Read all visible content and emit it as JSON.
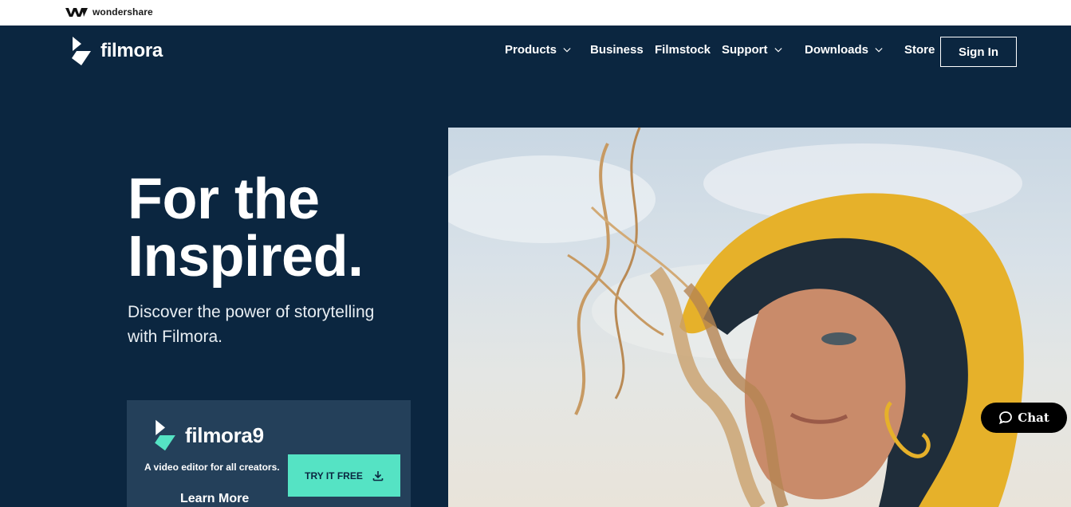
{
  "topbar": {
    "brand": "wondershare"
  },
  "nav": {
    "brand": "filmora",
    "items": [
      {
        "label": "Products",
        "dropdown": true
      },
      {
        "label": "Business",
        "dropdown": false
      },
      {
        "label": "Filmstock",
        "dropdown": false
      },
      {
        "label": "Support",
        "dropdown": true
      },
      {
        "label": "Downloads",
        "dropdown": true
      },
      {
        "label": "Store",
        "dropdown": false
      }
    ],
    "sign_in": "Sign In"
  },
  "hero": {
    "title_line1": "For the",
    "title_line2": "Inspired.",
    "subtitle_line1": "Discover the power of storytelling",
    "subtitle_line2": "with Filmora."
  },
  "product_card": {
    "brand": "filmora",
    "version": "9",
    "tagline": "A video editor for all creators.",
    "try_button": "TRY IT FREE",
    "learn_more": "Learn More"
  },
  "chat": {
    "label": "Chat"
  },
  "colors": {
    "background": "#0b2640",
    "card": "#24405a",
    "accent": "#55e3c4",
    "logo_primary": "#ffffff"
  },
  "icons": [
    "wondershare-logo",
    "filmora-logo",
    "chevron-down-icon",
    "download-icon",
    "chat-bubble-icon"
  ]
}
